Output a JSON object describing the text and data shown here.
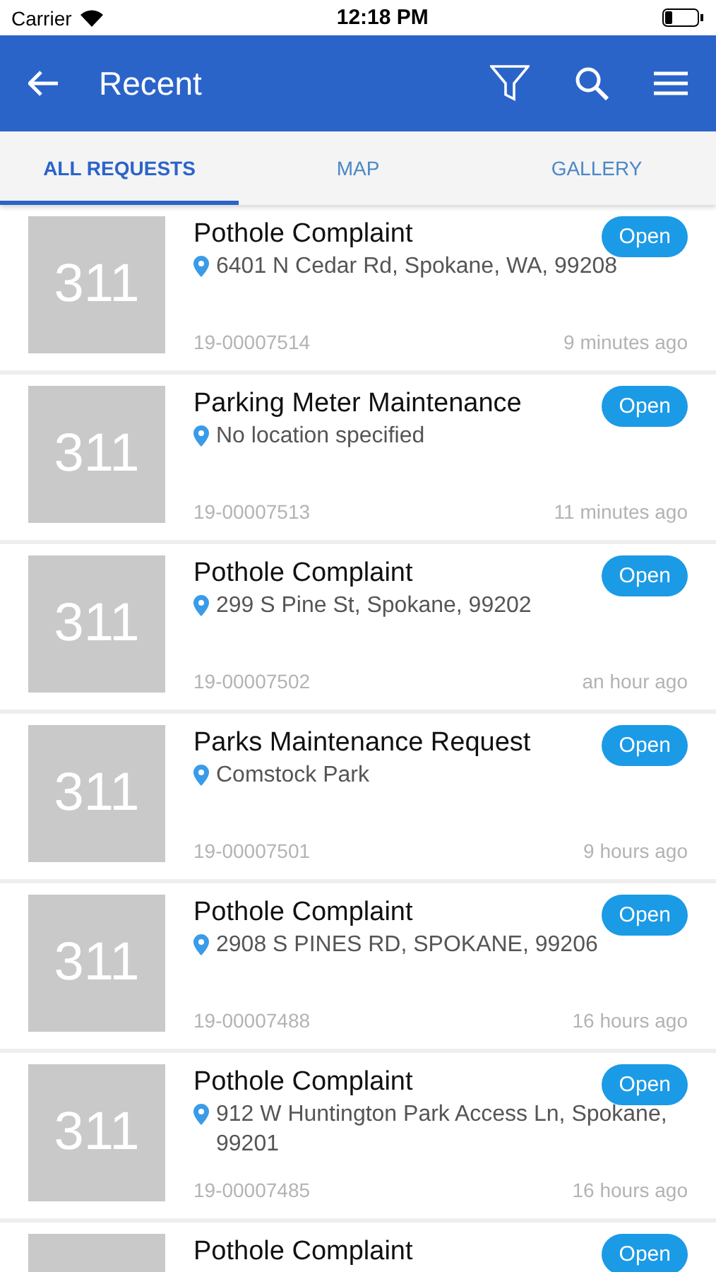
{
  "status_bar": {
    "carrier": "Carrier",
    "time": "12:18 PM"
  },
  "header": {
    "title": "Recent"
  },
  "tabs": [
    {
      "label": "ALL REQUESTS",
      "selected": true
    },
    {
      "label": "MAP",
      "selected": false
    },
    {
      "label": "GALLERY",
      "selected": false
    }
  ],
  "requests": [
    {
      "thumbnail": "311",
      "title": "Pothole Complaint",
      "status": "Open",
      "address": "6401 N Cedar Rd, Spokane, WA, 99208",
      "id": "19-00007514",
      "time": "9 minutes ago"
    },
    {
      "thumbnail": "311",
      "title": "Parking Meter Maintenance",
      "status": "Open",
      "address": "No location specified",
      "id": "19-00007513",
      "time": "11 minutes ago"
    },
    {
      "thumbnail": "311",
      "title": "Pothole Complaint",
      "status": "Open",
      "address": "299 S Pine St, Spokane, 99202",
      "id": "19-00007502",
      "time": "an hour ago"
    },
    {
      "thumbnail": "311",
      "title": "Parks Maintenance Request",
      "status": "Open",
      "address": "Comstock Park",
      "id": "19-00007501",
      "time": "9 hours ago"
    },
    {
      "thumbnail": "311",
      "title": "Pothole Complaint",
      "status": "Open",
      "address": "2908 S PINES RD, SPOKANE, 99206",
      "id": "19-00007488",
      "time": "16 hours ago"
    },
    {
      "thumbnail": "311",
      "title": "Pothole Complaint",
      "status": "Open",
      "address": "912 W Huntington Park Access Ln, Spokane, 99201",
      "id": "19-00007485",
      "time": "16 hours ago"
    },
    {
      "title": "Pothole Complaint",
      "status": "Open"
    }
  ]
}
